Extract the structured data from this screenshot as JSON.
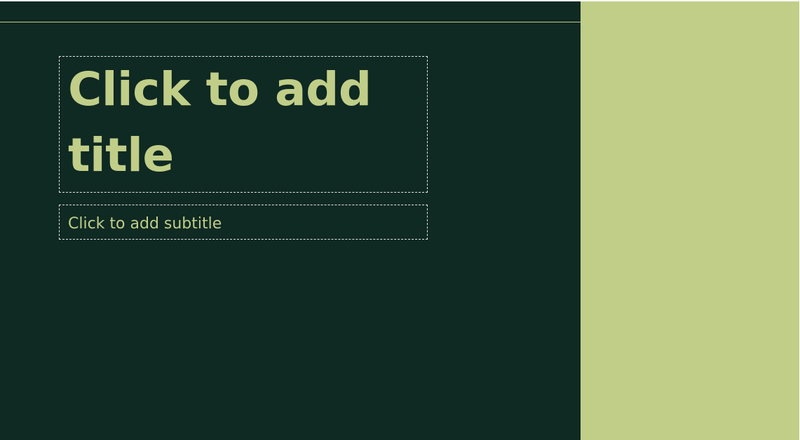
{
  "slide": {
    "title_placeholder": "Click to add title",
    "subtitle_placeholder": "Click to add subtitle"
  },
  "colors": {
    "background_dark": "#0f2923",
    "accent": "#c0ce88",
    "placeholder_border": "#e6e6e6"
  }
}
